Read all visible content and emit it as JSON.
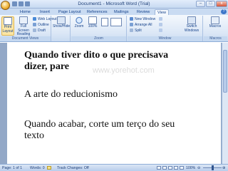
{
  "window": {
    "title": "Document1 - Microsoft Word (Trial)",
    "minimize_label": "–",
    "maximize_label": "□",
    "close_label": "x"
  },
  "tabs": [
    "Home",
    "Insert",
    "Page Layout",
    "References",
    "Mailings",
    "Review",
    "View"
  ],
  "active_tab": "View",
  "help_label": "?",
  "ribbon": {
    "document_views": {
      "group_label": "Document Views",
      "print_layout": "Print Layout",
      "full_screen_reading": "Full Screen Reading",
      "web_layout": "Web Layout",
      "outline": "Outline",
      "draft": "Draft"
    },
    "show_hide": {
      "label": "Show/Hide"
    },
    "zoom": {
      "group_label": "Zoom",
      "zoom": "Zoom",
      "hundred": "100%"
    },
    "window": {
      "group_label": "Window",
      "new_window": "New Window",
      "arrange_all": "Arrange All",
      "split": "Split",
      "switch_windows": "Switch Windows"
    },
    "macros": {
      "group_label": "Macros",
      "macros": "Macros"
    }
  },
  "document": {
    "line1": "Quando tiver dito o que precisava",
    "line2": "dizer, pare",
    "line3": "A arte do reducionismo",
    "line4": "Quando acabar, corte um terço do seu",
    "line5": "texto",
    "watermark": "www.yorehot.com"
  },
  "status": {
    "page": "Page: 1 of 1",
    "words": "Words: 0",
    "track_changes": "Track Changes: Off",
    "zoom": "100%"
  },
  "colors": {
    "ribbon_blue": "#c9dbf2",
    "doc_background": "#93a8c7",
    "title_text": "#1e3f78"
  }
}
